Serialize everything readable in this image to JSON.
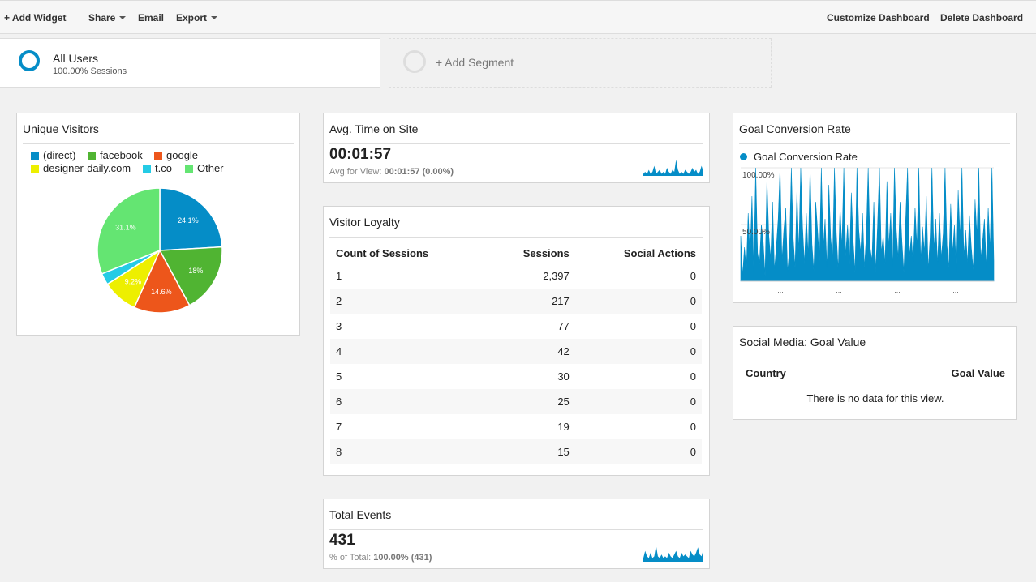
{
  "toolbar": {
    "add_widget": "+ Add Widget",
    "share": "Share",
    "email": "Email",
    "export": "Export",
    "customize": "Customize Dashboard",
    "delete": "Delete Dashboard"
  },
  "segments": {
    "all_users": {
      "title": "All Users",
      "subtitle": "100.00% Sessions"
    },
    "add_segment": "+ Add Segment"
  },
  "colors": {
    "direct": "#058dc7",
    "facebook": "#50b432",
    "google": "#ed561b",
    "designer_daily": "#edef00",
    "tco": "#24cbe5",
    "other": "#64e572",
    "accent": "#058dc7"
  },
  "unique_visitors": {
    "title": "Unique Visitors",
    "chart_data": {
      "type": "pie",
      "slices": [
        {
          "name": "(direct)",
          "value": 24.1,
          "label": "24.1%"
        },
        {
          "name": "facebook",
          "value": 18.0,
          "label": "18%"
        },
        {
          "name": "google",
          "value": 14.6,
          "label": "14.6%"
        },
        {
          "name": "designer-daily.com",
          "value": 9.2,
          "label": "9.2%"
        },
        {
          "name": "t.co",
          "value": 3.0,
          "label": ""
        },
        {
          "name": "Other",
          "value": 31.1,
          "label": "31.1%"
        }
      ],
      "legend_placement": "top"
    }
  },
  "avg_time": {
    "title": "Avg. Time on Site",
    "value": "00:01:57",
    "sub_prefix": "Avg for View:",
    "sub_value": "00:01:57",
    "sub_pct": "(0.00%)"
  },
  "visitor_loyalty": {
    "title": "Visitor Loyalty",
    "columns": [
      "Count of Sessions",
      "Sessions",
      "Social Actions"
    ],
    "rows": [
      [
        "1",
        "2,397",
        "0"
      ],
      [
        "2",
        "217",
        "0"
      ],
      [
        "3",
        "77",
        "0"
      ],
      [
        "4",
        "42",
        "0"
      ],
      [
        "5",
        "30",
        "0"
      ],
      [
        "6",
        "25",
        "0"
      ],
      [
        "7",
        "19",
        "0"
      ],
      [
        "8",
        "15",
        "0"
      ]
    ]
  },
  "total_events": {
    "title": "Total Events",
    "value": "431",
    "sub_prefix": "% of Total:",
    "sub_value": "100.00%",
    "sub_pct": "(431)"
  },
  "goal_conversion": {
    "title": "Goal Conversion Rate",
    "chart_data": {
      "type": "area",
      "series_name": "Goal Conversion Rate",
      "y_ticks": [
        "100.00%",
        "50.00%"
      ],
      "ylim": [
        0,
        100
      ],
      "x_tick_labels": [
        "...",
        "...",
        "...",
        "..."
      ],
      "values": [
        40,
        5,
        30,
        10,
        60,
        20,
        75,
        8,
        100,
        25,
        15,
        50,
        35,
        5,
        90,
        40,
        20,
        70,
        10,
        30,
        55,
        100,
        18,
        45,
        65,
        8,
        28,
        100,
        38,
        12,
        80,
        25,
        100,
        48,
        15,
        60,
        22,
        100,
        33,
        9,
        70,
        45,
        18,
        100,
        28,
        55,
        12,
        85,
        38,
        20,
        100,
        42,
        10,
        65,
        30,
        100,
        22,
        50,
        15,
        78,
        35,
        8,
        100,
        45,
        25,
        60,
        12,
        40,
        100,
        30,
        18,
        70,
        8,
        50,
        100,
        25,
        40,
        15,
        88,
        30,
        60,
        12,
        100,
        45,
        20,
        70,
        35,
        8,
        55,
        100,
        22,
        40,
        15,
        65,
        30,
        100,
        18,
        48,
        25,
        75,
        10,
        38,
        100,
        28,
        55,
        15,
        60,
        20,
        42,
        100,
        32,
        12,
        68,
        25,
        50,
        8,
        80,
        38,
        100,
        22,
        45,
        15,
        58,
        30,
        10,
        72,
        40,
        100,
        20,
        35,
        55,
        12,
        65,
        28,
        100,
        18
      ]
    }
  },
  "goal_value": {
    "title": "Social Media: Goal Value",
    "columns": [
      "Country",
      "Goal Value"
    ],
    "empty_message": "There is no data for this view."
  },
  "sparkline_avg": [
    1,
    2,
    1,
    3,
    1,
    2,
    5,
    1,
    2,
    3,
    1,
    2,
    1,
    4,
    2,
    1,
    3,
    2,
    8,
    3,
    1,
    2,
    1,
    3,
    2,
    1,
    2,
    4,
    2,
    3,
    1,
    2,
    5,
    2
  ],
  "sparkline_events": [
    2,
    6,
    3,
    2,
    5,
    2,
    3,
    9,
    3,
    2,
    4,
    2,
    3,
    2,
    5,
    3,
    2,
    4,
    6,
    3,
    2,
    5,
    3,
    4,
    3,
    2,
    6,
    4,
    3,
    5,
    8,
    4,
    3,
    7
  ]
}
